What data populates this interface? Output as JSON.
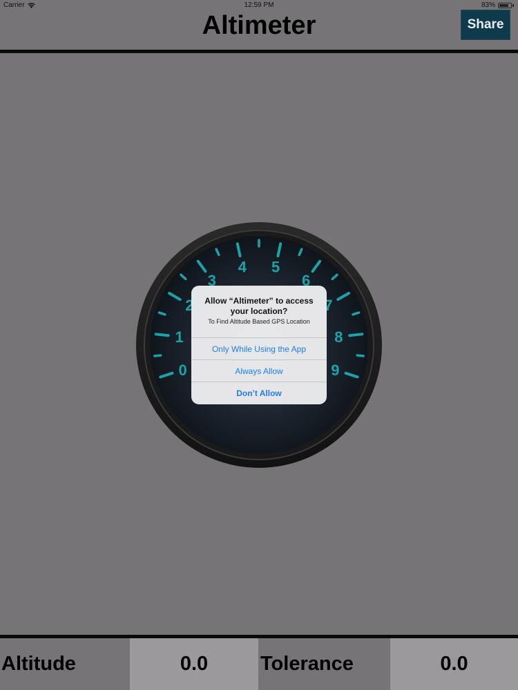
{
  "status_bar": {
    "carrier": "Carrier",
    "time": "12:59 PM",
    "battery": "83%",
    "battery_level": 0.83
  },
  "header": {
    "title": "Altimeter",
    "share_label": "Share"
  },
  "gauge": {
    "numerals": [
      "0",
      "1",
      "2",
      "3",
      "4",
      "5",
      "6",
      "7",
      "8",
      "9"
    ],
    "tick_color": "#1aa3a8"
  },
  "dialog": {
    "title": "Allow “Altimeter” to access your location?",
    "message": "To Find Altitude Based GPS Location",
    "buttons": {
      "while_using": "Only While Using the App",
      "always": "Always Allow",
      "dont_allow": "Don’t Allow"
    }
  },
  "footer": {
    "altitude_label": "Altitude",
    "altitude_value": "0.0",
    "tolerance_label": "Tolerance",
    "tolerance_value": "0.0"
  }
}
